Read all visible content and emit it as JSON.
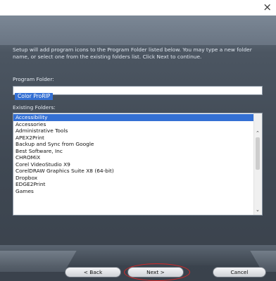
{
  "window": {
    "close_label": "×"
  },
  "description": "Setup will add program icons to the Program Folder listed below.  You may type a new folder name, or select one from the existing folders list.  Click Next to continue.",
  "program_folder": {
    "label": "Program Folder:",
    "value": "Color ProRIP"
  },
  "existing_folders": {
    "label": "Existing Folders:",
    "selected": "Accessibility",
    "items": [
      "Accessibility",
      "Accessories",
      "Administrative Tools",
      "APEX2Print",
      "Backup and Sync from Google",
      "Best Software, Inc",
      "CHROMiX",
      "Corel VideoStudio X9",
      "CorelDRAW Graphics Suite X8 (64-bit)",
      "Dropbox",
      "EDGE2Print",
      "Games"
    ]
  },
  "buttons": {
    "back": "< Back",
    "next": "Next >",
    "cancel": "Cancel"
  },
  "colors": {
    "selection": "#3470d4",
    "highlight_circle": "#d62828"
  }
}
